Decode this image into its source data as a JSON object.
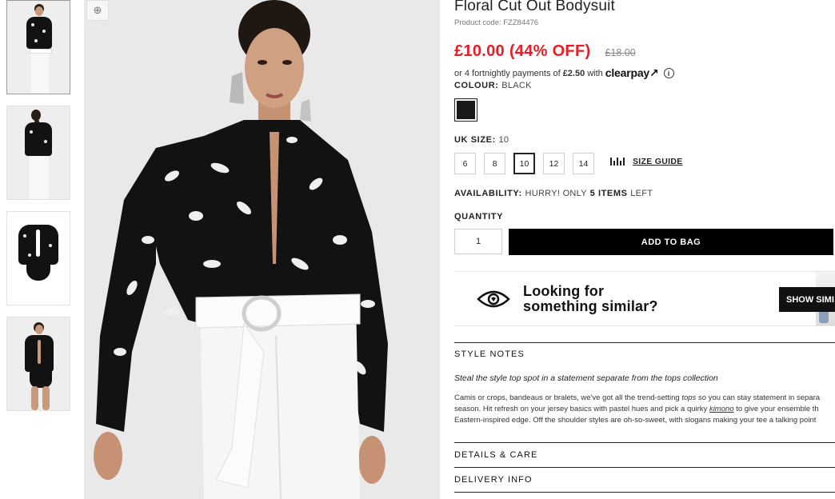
{
  "thumbnails": [
    {
      "name": "front-view",
      "active": true
    },
    {
      "name": "back-view",
      "active": false
    },
    {
      "name": "flat-view",
      "active": false
    },
    {
      "name": "bodysuit-view",
      "active": false
    }
  ],
  "zoom_icon": "magnifier-plus-icon",
  "product": {
    "title": "Floral Cut Out Bodysuit",
    "code": "Product code: FZZ84476",
    "price": "£10.00 (44% OFF)",
    "rrp": "£18.00"
  },
  "clearpay": {
    "prefix": "or 4 fortnightly payments of",
    "amount": "£2.50",
    "with": "with",
    "logo": "clearpay",
    "info_icon": "i"
  },
  "colour": {
    "label": "COLOUR:",
    "value": "BLACK",
    "swatch_color": "#1a1a1a"
  },
  "size": {
    "label": "UK SIZE:",
    "value": "10",
    "options": [
      "6",
      "8",
      "10",
      "12",
      "14"
    ],
    "selected": "10",
    "guide": "SIZE GUIDE"
  },
  "availability": {
    "label": "AVAILABILITY:",
    "pre": "HURRY! ONLY",
    "count": "5 ITEMS",
    "post": "LEFT"
  },
  "quantity": {
    "label": "QUANTITY",
    "value": "1"
  },
  "add_to_bag": "ADD TO BAG",
  "similar": {
    "line1": "Looking for",
    "line2": "something similar?",
    "button": "SHOW SIMI"
  },
  "style_notes": {
    "heading": "STYLE NOTES",
    "subheading": "Steal the style top spot in a statement separate from the tops collection",
    "p1": "Camis or crops, bandeaus or bralets, we've got all the trend-setting",
    "p1_em": "tops",
    "p2": "so you can stay statement in separa",
    "p3": "season. Hit refresh on your jersey basics with pastel hues and pick a quirky",
    "p3_em": "kimono",
    "p4": "to give your ensemble th",
    "p5": "Eastern-inspired edge. Off the shoulder styles are oh-so-sweet, with slogans making your tee a talking point"
  },
  "details_care": "DETAILS & CARE",
  "delivery_info": "DELIVERY INFO",
  "colors": {
    "price_red": "#e41e26",
    "button_black": "#000000"
  }
}
